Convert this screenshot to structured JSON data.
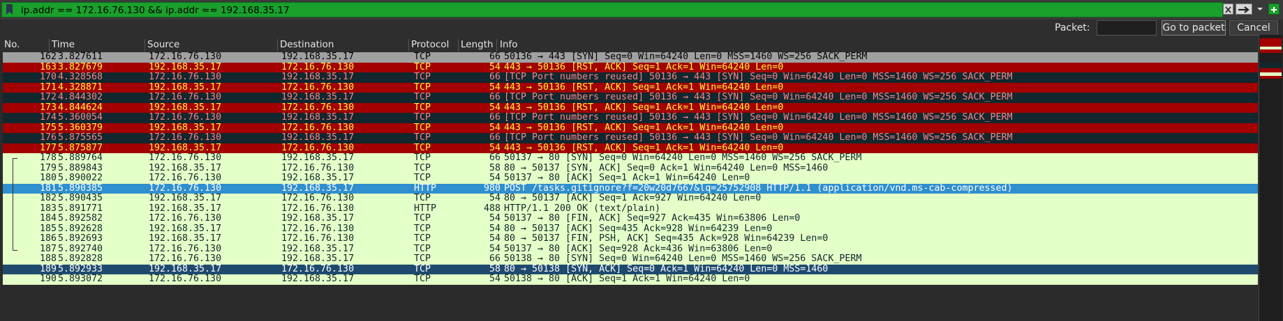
{
  "filter": {
    "text": "ip.addr == 172.16.76.130 && ip.addr == 192.168.35.17"
  },
  "goto": {
    "label": "Packet:",
    "value": "",
    "go_label": "Go to packet",
    "cancel_label": "Cancel"
  },
  "columns": [
    "No.",
    "Time",
    "Source",
    "Destination",
    "Protocol",
    "Length",
    "Info"
  ],
  "colors": {
    "gray": "#a0a0a0",
    "red": "#a40000",
    "darkteal": "#12272e",
    "green": "#e4ffc7",
    "selected": "#2f8fcf",
    "navy": "#1e4a6e"
  },
  "packets": [
    {
      "no": "162",
      "time": "3.827611",
      "src": "172.16.76.130",
      "dst": "192.168.35.17",
      "proto": "TCP",
      "len": "66",
      "info": "50136 → 443 [SYN] Seq=0 Win=64240 Len=0 MSS=1460 WS=256 SACK_PERM",
      "style": "gray"
    },
    {
      "no": "163",
      "time": "3.827679",
      "src": "192.168.35.17",
      "dst": "172.16.76.130",
      "proto": "TCP",
      "len": "54",
      "info": "443 → 50136 [RST, ACK] Seq=1 Ack=1 Win=64240 Len=0",
      "style": "red"
    },
    {
      "no": "170",
      "time": "4.328568",
      "src": "172.16.76.130",
      "dst": "192.168.35.17",
      "proto": "TCP",
      "len": "66",
      "info": "[TCP Port numbers reused] 50136 → 443 [SYN] Seq=0 Win=64240 Len=0 MSS=1460 WS=256 SACK_PERM",
      "style": "darkteal"
    },
    {
      "no": "171",
      "time": "4.328871",
      "src": "192.168.35.17",
      "dst": "172.16.76.130",
      "proto": "TCP",
      "len": "54",
      "info": "443 → 50136 [RST, ACK] Seq=1 Ack=1 Win=64240 Len=0",
      "style": "red"
    },
    {
      "no": "172",
      "time": "4.844302",
      "src": "172.16.76.130",
      "dst": "192.168.35.17",
      "proto": "TCP",
      "len": "66",
      "info": "[TCP Port numbers reused] 50136 → 443 [SYN] Seq=0 Win=64240 Len=0 MSS=1460 WS=256 SACK_PERM",
      "style": "darkteal"
    },
    {
      "no": "173",
      "time": "4.844624",
      "src": "192.168.35.17",
      "dst": "172.16.76.130",
      "proto": "TCP",
      "len": "54",
      "info": "443 → 50136 [RST, ACK] Seq=1 Ack=1 Win=64240 Len=0",
      "style": "red"
    },
    {
      "no": "174",
      "time": "5.360054",
      "src": "172.16.76.130",
      "dst": "192.168.35.17",
      "proto": "TCP",
      "len": "66",
      "info": "[TCP Port numbers reused] 50136 → 443 [SYN] Seq=0 Win=64240 Len=0 MSS=1460 WS=256 SACK_PERM",
      "style": "darkteal"
    },
    {
      "no": "175",
      "time": "5.360379",
      "src": "192.168.35.17",
      "dst": "172.16.76.130",
      "proto": "TCP",
      "len": "54",
      "info": "443 → 50136 [RST, ACK] Seq=1 Ack=1 Win=64240 Len=0",
      "style": "red"
    },
    {
      "no": "176",
      "time": "5.875565",
      "src": "172.16.76.130",
      "dst": "192.168.35.17",
      "proto": "TCP",
      "len": "66",
      "info": "[TCP Port numbers reused] 50136 → 443 [SYN] Seq=0 Win=64240 Len=0 MSS=1460 WS=256 SACK_PERM",
      "style": "darkteal"
    },
    {
      "no": "177",
      "time": "5.875877",
      "src": "192.168.35.17",
      "dst": "172.16.76.130",
      "proto": "TCP",
      "len": "54",
      "info": "443 → 50136 [RST, ACK] Seq=1 Ack=1 Win=64240 Len=0",
      "style": "red"
    },
    {
      "no": "178",
      "time": "5.889764",
      "src": "172.16.76.130",
      "dst": "192.168.35.17",
      "proto": "TCP",
      "len": "66",
      "info": "50137 → 80 [SYN] Seq=0 Win=64240 Len=0 MSS=1460 WS=256 SACK_PERM",
      "style": "green"
    },
    {
      "no": "179",
      "time": "5.889843",
      "src": "192.168.35.17",
      "dst": "172.16.76.130",
      "proto": "TCP",
      "len": "58",
      "info": "80 → 50137 [SYN, ACK] Seq=0 Ack=1 Win=64240 Len=0 MSS=1460",
      "style": "green"
    },
    {
      "no": "180",
      "time": "5.890022",
      "src": "172.16.76.130",
      "dst": "192.168.35.17",
      "proto": "TCP",
      "len": "54",
      "info": "50137 → 80 [ACK] Seq=1 Ack=1 Win=64240 Len=0",
      "style": "green"
    },
    {
      "no": "181",
      "time": "5.890385",
      "src": "172.16.76.130",
      "dst": "192.168.35.17",
      "proto": "HTTP",
      "len": "980",
      "info": "POST /tasks.gitignore?f=20w20d7667&lq=25752908 HTTP/1.1  (application/vnd.ms-cab-compressed)",
      "style": "selected"
    },
    {
      "no": "182",
      "time": "5.890435",
      "src": "192.168.35.17",
      "dst": "172.16.76.130",
      "proto": "TCP",
      "len": "54",
      "info": "80 → 50137 [ACK] Seq=1 Ack=927 Win=64240 Len=0",
      "style": "green"
    },
    {
      "no": "183",
      "time": "5.891771",
      "src": "192.168.35.17",
      "dst": "172.16.76.130",
      "proto": "HTTP",
      "len": "488",
      "info": "HTTP/1.1 200 OK  (text/plain)",
      "style": "green"
    },
    {
      "no": "184",
      "time": "5.892582",
      "src": "172.16.76.130",
      "dst": "192.168.35.17",
      "proto": "TCP",
      "len": "54",
      "info": "50137 → 80 [FIN, ACK] Seq=927 Ack=435 Win=63806 Len=0",
      "style": "green"
    },
    {
      "no": "185",
      "time": "5.892628",
      "src": "192.168.35.17",
      "dst": "172.16.76.130",
      "proto": "TCP",
      "len": "54",
      "info": "80 → 50137 [ACK] Seq=435 Ack=928 Win=64239 Len=0",
      "style": "green"
    },
    {
      "no": "186",
      "time": "5.892693",
      "src": "192.168.35.17",
      "dst": "172.16.76.130",
      "proto": "TCP",
      "len": "54",
      "info": "80 → 50137 [FIN, PSH, ACK] Seq=435 Ack=928 Win=64239 Len=0",
      "style": "green"
    },
    {
      "no": "187",
      "time": "5.892740",
      "src": "172.16.76.130",
      "dst": "192.168.35.17",
      "proto": "TCP",
      "len": "54",
      "info": "50137 → 80 [ACK] Seq=928 Ack=436 Win=63806 Len=0",
      "style": "green"
    },
    {
      "no": "188",
      "time": "5.892828",
      "src": "172.16.76.130",
      "dst": "192.168.35.17",
      "proto": "TCP",
      "len": "66",
      "info": "50138 → 80 [SYN] Seq=0 Win=64240 Len=0 MSS=1460 WS=256 SACK_PERM",
      "style": "green"
    },
    {
      "no": "189",
      "time": "5.892933",
      "src": "192.168.35.17",
      "dst": "172.16.76.130",
      "proto": "TCP",
      "len": "58",
      "info": "80 → 50138 [SYN, ACK] Seq=0 Ack=1 Win=64240 Len=0 MSS=1460",
      "style": "navy"
    },
    {
      "no": "190",
      "time": "5.893072",
      "src": "172.16.76.130",
      "dst": "192.168.35.17",
      "proto": "TCP",
      "len": "54",
      "info": "50138 → 80 [ACK] Seq=1 Ack=1 Win=64240 Len=0",
      "style": "green"
    }
  ]
}
